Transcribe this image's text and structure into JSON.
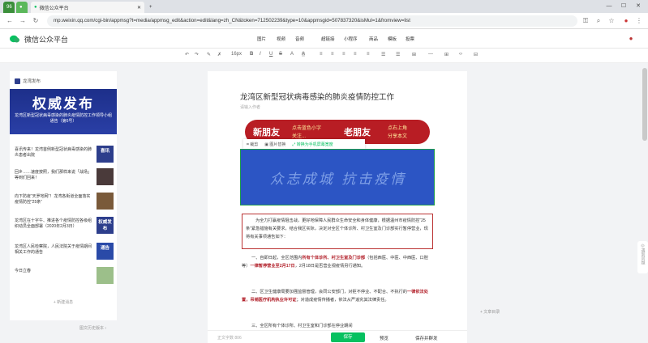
{
  "browser": {
    "tabs": [
      "96",
      "",
      "微信公众平台"
    ],
    "url": "mp.weixin.qq.com/cgi-bin/appmsg?t=media/appmsg_edit&action=edit&lang=zh_CN&token=712502239&type=10&appmsgid=507837320&isMul=1&fromview=list",
    "win": [
      "—",
      "☐",
      "✕"
    ],
    "nav": [
      "←",
      "→",
      "↻"
    ],
    "icons": [
      "☆",
      "⋮"
    ]
  },
  "app": {
    "title": "微信公众平台",
    "menu": [
      "图片",
      "视频",
      "音频",
      "超链接",
      "小程序",
      "商品",
      "模板",
      "投票"
    ]
  },
  "format": {
    "undo": "↶",
    "redo": "↷",
    "fontsize": "16px",
    "buttons": [
      "B",
      "I",
      "U",
      "S",
      "A",
      "A",
      "≡",
      "≡",
      "≡",
      "≡",
      "≡",
      "☰",
      "☰",
      "⊞",
      "—",
      "⊞",
      "‹›",
      "⊟"
    ]
  },
  "left": {
    "account": "龙湾发布",
    "cover_big": "权威发布",
    "cover_sub": "龙湾区新型冠状病毒感染的肺炎疫情防控工作领导小组通告（第6号）",
    "articles": [
      {
        "title": "喜讯传来！龙湾首例新型冠状病毒感染的肺炎患者出院",
        "thumb": "喜讯",
        "color": "#2d3e8c"
      },
      {
        "title": "回乡……速度按照，我们那样来说「战场」等到们回来！",
        "thumb": "",
        "color": "#4a3a3a"
      },
      {
        "title": "向下防疫“天罗地网”！龙湾各街道全面落实疫情防控“25条”",
        "thumb": "",
        "color": "#7a5a3a"
      },
      {
        "title": "龙湾区在十字午、推进各个疫情防控各级组织动员全面部署（2020年2月3日）",
        "thumb": "权威发布",
        "color": "#2d3e8c"
      },
      {
        "title": "龙湾区人民检察院，人民法院关于疫情期间相关工作的通告",
        "thumb": "通告",
        "color": "#2a4aa8"
      },
      {
        "title": "今日立春",
        "thumb": "",
        "color": "#9cbf8a"
      }
    ],
    "new_message": "+ 新建消息",
    "history": "图文历史版本 ›"
  },
  "editor": {
    "title": "龙湾区新型冠状病毒感染的肺炎疫情防控工作",
    "author": "请输入作者",
    "banner": {
      "left_big": "新朋友",
      "left_small_1": "点击蓝色小字",
      "left_small_2": "关注...",
      "right_big": "老朋友",
      "right_small_1": "点右上角",
      "right_small_2": "分享本文"
    },
    "imgtools": [
      "裁剪",
      "图片替换",
      "转换为手机屏幕宽度"
    ],
    "hero_text": "众志成城  抗击疫情",
    "notice": "为全力打赢疫情阻击战，更好地保障人民群众生命安全和身体健康，根据温州市疫情防控“25条”紧急措施有关要求，结合我区实际，决定对全区个体诊所、村卫生室及门诊部实行暂停营业，现将有关事项通告如下：",
    "para1_a": "一、自即日起，全区范围内",
    "para1_em": "所有个体诊所、村卫生室及门诊部",
    "para1_b": "（包括西医、中医、中西医、口腔等）",
    "para1_em2": "一律暂停营业至2月17日",
    "para1_c": "，2月18日是否营业视疫情另行通知。",
    "para2_a": "二、区卫生健康局要加强监督管理，会同公安部门，对拒不停业、不配合、不执行的",
    "para2_em": "一律依法处置，吊销医疗机构执业许可证",
    "para2_b": "；对造成疫情传播者，依法从严追究其法律责任。",
    "para3": "三、全区所有个体诊所、村卫生室和门诊部在停业期间"
  },
  "bottom": {
    "wordcount": "正文字数 806",
    "save": "保存",
    "preview": "预览",
    "publish": "保存并群发"
  },
  "side": {
    "label": "遇到问题",
    "outline": "+ 文章目录"
  }
}
